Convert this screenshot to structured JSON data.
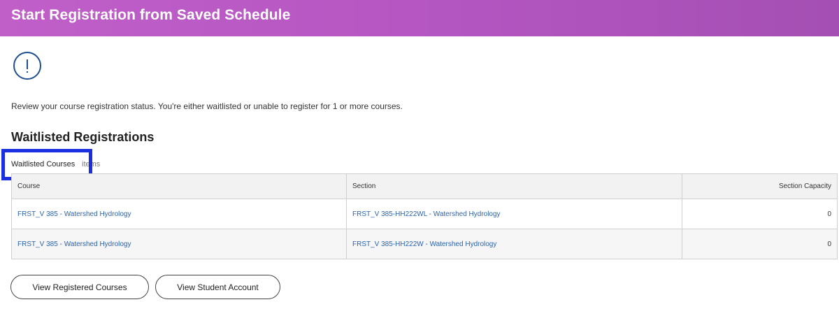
{
  "header": {
    "title": "Start Registration from Saved Schedule"
  },
  "message": "Review your course registration status. You're either waitlisted or unable to register for 1 or more courses.",
  "waitlisted": {
    "heading": "Waitlisted Registrations",
    "table_title": "Waitlisted Courses",
    "items_label": "items",
    "columns": [
      "Course",
      "Section",
      "Section Capacity"
    ],
    "rows": [
      {
        "course": "FRST_V 385 - Watershed Hydrology",
        "section": "FRST_V 385-HH222WL - Watershed Hydrology",
        "capacity": "0"
      },
      {
        "course": "FRST_V 385 - Watershed Hydrology",
        "section": "FRST_V 385-HH222W - Watershed Hydrology",
        "capacity": "0"
      }
    ]
  },
  "buttons": {
    "view_registered": "View Registered Courses",
    "view_account": "View Student Account"
  },
  "colors": {
    "header_gradient_start": "#c05fc8",
    "header_gradient_end": "#a44fb3",
    "link": "#2b63b0",
    "icon": "#1f4f8f",
    "highlight": "#1a2fe0"
  },
  "icons": {
    "alert": "exclamation-circle-icon"
  }
}
